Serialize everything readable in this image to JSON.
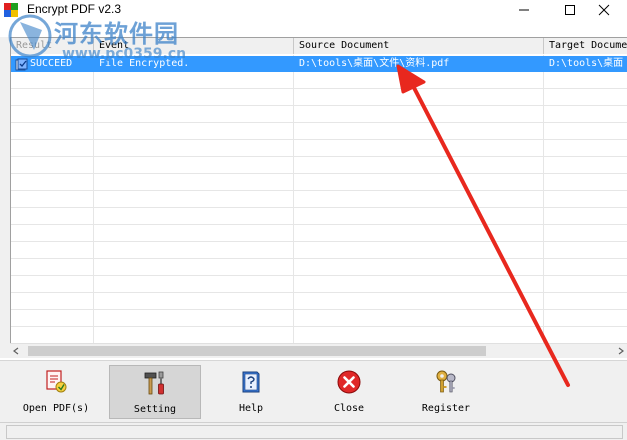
{
  "window": {
    "title": "Encrypt PDF v2.3"
  },
  "watermark": {
    "name": "河东软件园",
    "url": "www.pc0359.cn"
  },
  "list": {
    "columns": [
      "Result",
      "Event",
      "Source Document",
      "Target Document"
    ],
    "rows": [
      {
        "result": "SUCCEED",
        "event": "File Encrypted.",
        "source": "D:\\tools\\桌面\\文件\\资料.pdf",
        "target": "D:\\tools\\桌面"
      }
    ]
  },
  "toolbar": {
    "open_label": "Open PDF(s)",
    "setting_label": "Setting",
    "help_label": "Help",
    "close_label": "Close",
    "register_label": "Register"
  },
  "colors": {
    "selection": "#3399ff",
    "annotation": "#e8281e"
  }
}
